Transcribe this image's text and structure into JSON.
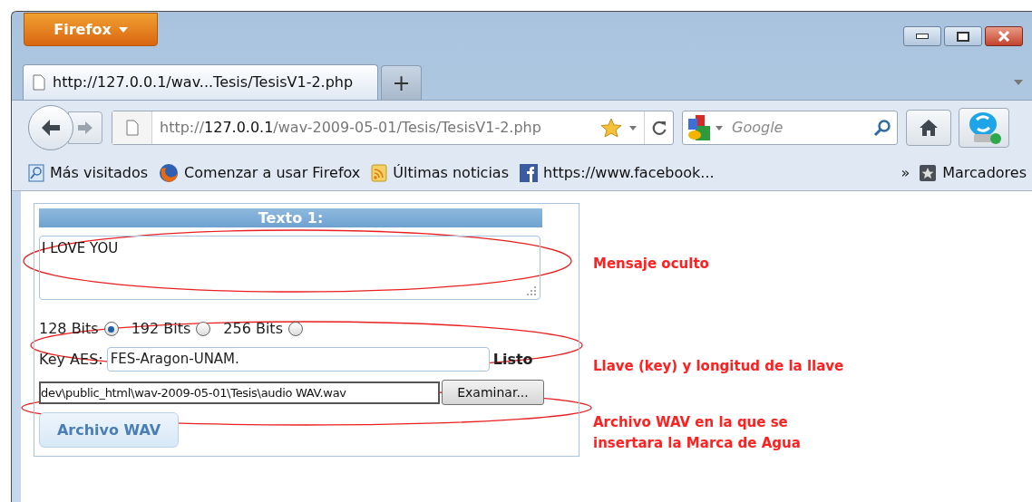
{
  "browser": {
    "menu_button": "Firefox",
    "tabs": [
      {
        "label": "http://127.0.0.1/wav...Tesis/TesisV1-2.php",
        "selected": true
      }
    ],
    "new_tab": "+",
    "address": {
      "scheme": "http://",
      "host": "127.0.0.1",
      "path": "/wav-2009-05-01/Tesis/TesisV1-2.php"
    },
    "search": {
      "placeholder": "Google"
    },
    "bookmarks": [
      {
        "label": "Más visitados",
        "kind": "search"
      },
      {
        "label": "Comenzar a usar Firefox",
        "kind": "firefox"
      },
      {
        "label": "Últimas noticias",
        "kind": "feed"
      },
      {
        "label": "https://www.facebook...",
        "kind": "facebook"
      }
    ],
    "bookmarks_overflow": "»",
    "bookmarks_menu": "Marcadores"
  },
  "page": {
    "header": "Texto 1:",
    "message": "I LOVE YOU",
    "key_lengths": [
      {
        "label": "128 Bits",
        "selected": true
      },
      {
        "label": "192 Bits",
        "selected": false
      },
      {
        "label": "256 Bits",
        "selected": false
      }
    ],
    "key_label": "Key AES:",
    "key_value": "FES-Aragon-UNAM.",
    "key_status": "Listo",
    "file_path": "dev\\public_html\\wav-2009-05-01\\Tesis\\audio WAV.wav",
    "browse_button": "Examinar...",
    "submit_button": "Archivo WAV"
  },
  "annotations": [
    "Mensaje oculto",
    "Llave (key) y longitud de la llave",
    "Archivo WAV en la que se insertara la Marca de Agua"
  ]
}
